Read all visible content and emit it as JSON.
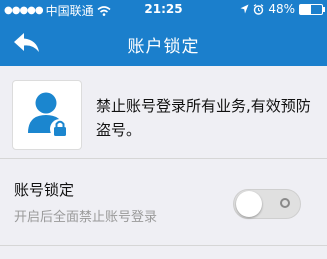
{
  "status_bar": {
    "carrier": "中国联通",
    "time": "21:25",
    "battery_text": "48%",
    "battery_level": 0.48
  },
  "nav": {
    "title": "账户锁定",
    "back_icon": "back-arrow-icon"
  },
  "info": {
    "description": "禁止账号登录所有业务,有效预防盗号。",
    "icon": "user-lock-icon"
  },
  "setting": {
    "label": "账号锁定",
    "hint": "开启后全面禁止账号登录",
    "enabled": false
  },
  "colors": {
    "primary": "#1b7fcc",
    "background": "#efeff4"
  }
}
